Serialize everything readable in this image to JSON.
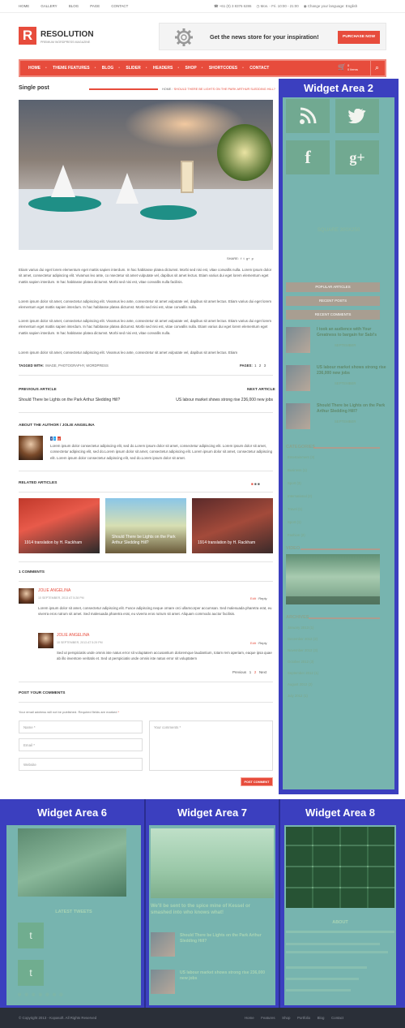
{
  "topbar": {
    "nav": [
      "HOME",
      "GALLERY",
      "BLOG",
      "PAGE",
      "CONTACT"
    ],
    "phone": "+61 (0) 3 8376 6286",
    "hours": "Mon. - Fri. 10:00 - 21:00",
    "language_label": "Change your language:",
    "language": "English"
  },
  "header": {
    "logo_letter": "R",
    "logo_title": "RESOLUTION",
    "logo_sub": "PREMIUM WORDPRESS MAGAZINE",
    "banner_text": "Get the news store for your inspiration!",
    "banner_button": "PURCHASE NOW"
  },
  "mainnav": {
    "items": [
      "HOME",
      "THEME FEATURES",
      "BLOG",
      "SLIDER",
      "HEADERS",
      "SHOP",
      "SHORTCODES",
      "CONTACT"
    ],
    "cart_count": "0",
    "cart_label": "0 items"
  },
  "page": {
    "title": "Single post",
    "breadcrumb_home": "HOME",
    "breadcrumb_current": "SHOULD THERE BE LIGHTS ON THE PARK ARTHUR SLEDDING HILL?"
  },
  "article": {
    "share_label": "SHARE:",
    "paragraphs": [
      "Etiam varius dui eget lorem elementum eget mattis sapien interdum. In hac habitasse platea dictumst. Morbi sed nisi est, vitae convallis nulla. Lorem ipsum dolor sit amet, consectetur adipiscing elit. Vivamus leo ante, co nsectetur sit amet vulputate vel, dapibus sit amet lectus. Etiam varius dui eget lorem elementum eget mattis sapien interdum. In hac habitasse platea dictumst. Morbi sed nisi est, vitae convallis nulla facilisis.",
      "Lorem ipsum dolor sit amet, consectetur adipiscing elit. Vivamus leo ante, consectetur sit amet vulputate vel, dapibus sit amet lectus. Etiam varius dui eget lorem elementum eget mattis sapien interdum. In hac habitasse platea dictumst. Morbi sed nisi est, vitae convallis nulla.",
      "Lorem ipsum dolor sit amet, consectetur adipiscing elit. Vivamus leo ante, consectetur sit amet vulputate vel, dapibus sit amet lectus. Etiam varius dui eget lorem elementum eget mattis sapien interdum. In hac habitasse platea dictumst. Morbi sed nisi est, vitae convallis nulla. Etiam varius dui eget lorem elementum eget mattis sapien interdum. In hac habitasse platea dictumst. Morbi sed nisi est, vitae convallis nulla.",
      "Lorem ipsum dolor sit amet, consectetur adipiscing elit. Vivamus leo ante, consectetur sit amet vulputate vel, dapibus sit amet lectus. Etiam"
    ],
    "tagged_label": "TAGGED WITH:",
    "tags": "IMAGE, PHOTOGRAPHY, WORDPRESS",
    "pages_label": "PAGES:",
    "pages": [
      "1",
      "2",
      "3"
    ],
    "prev_label": "PREVIOUS ARTICLE",
    "prev_title": "Should There be Lights on the Park Arthur Sledding Hill?",
    "next_label": "NEXT ARTICLE",
    "next_title": "US labour market shows strong rise 236,000 new jobs",
    "author_heading": "ABOUT THE AUTHOR / JOLIE ANGELINA",
    "author_bio": "Lorem ipsum dolor consectetur adipiscing elit, sed do.Lorem ipsum dolor sit amet, consectetur adipiscing elit. Lorem ipsum dolor sit amet, consectetur adipiscing elit, sed do.Lorem ipsum dolor sit amet, consectetur adipiscing elit. Lorem ipsum dolor sit amet, consectetur adipiscing elit. Lorem ipsum dolor consectetur adipiscing elit, sed do.Lorem ipsum dolor sit amet."
  },
  "related": {
    "heading": "RELATED ARTICLES",
    "items": [
      "1914 translation by H. Rackham",
      "Should There be Lights on the Park Arthur Sledding Hill?",
      "1914 translation by H. Rackham"
    ]
  },
  "comments": {
    "heading": "1 COMMENTS",
    "list": [
      {
        "author": "JOLIE ANGELINA",
        "date": "10 SEPTEMBER, 2013 AT 5:28 PM",
        "edit": "Edit",
        "reply": "Reply",
        "text": "Lorem ipsum dolor sit amet, consectetur adipiscing elit. Fusce adipiscing neque ornare orci ullamcorper accumsan. Sed malesuada pharetra erat, eu viverra eros rutrum sit amet. Sed malesuada pharetra erat, eu viverra eros rutrum sit amet. Aliquam commodo auctor facilisis."
      },
      {
        "author": "JOLIE ANGELINA",
        "date": "10 SEPTEMBER, 2013 AT 5:29 PM",
        "edit": "Edit",
        "reply": "Reply",
        "text": "Sed ut perspiciatis unde omnis iste natus error sit voluptatem accusantium doloremque laudantium, totam rem aperiam, eaque ipsa quae ab illo inventore veritatis et. Sed ut perspiciatis unde omnis iste natus error sit voluptatem"
      }
    ],
    "pager_prev": "Previous",
    "pager_pages": [
      "1",
      "2"
    ],
    "pager_next": "Next"
  },
  "form": {
    "heading": "POST YOUR COMMENTS",
    "note": "Your email address will not be published. Required fields are marked",
    "required_mark": "*",
    "name_placeholder": "Name *",
    "email_placeholder": "Email *",
    "website_placeholder": "Website",
    "comment_placeholder": "Your comments *",
    "submit": "POST COMMENT"
  },
  "sidebar": {
    "label": "Widget Area 2",
    "ad_text": "SQUARE 300X250",
    "tabs": [
      "POPULAR ARTICLES",
      "RECENT POSTS",
      "RECENT COMMENTS"
    ],
    "posts": [
      {
        "title": "I took an audience with Your Greatness to bargain for Sabi's",
        "meta": "SEPTEMBER"
      },
      {
        "title": "US labour market shows strong rise 236,000 new jobs",
        "meta": "SEPTEMBER"
      },
      {
        "title": "Should There be Lights on the Park Arthur Sledding Hill?",
        "meta": "SEPTEMBER"
      }
    ],
    "categories_heading": "CATEGORIES",
    "categories": [
      "Entertainment (3)",
      "Business (1)",
      "Sport (3)",
      "International (2)",
      "Travel (1)",
      "Sport (1)",
      "Fashion (2)"
    ],
    "video_heading": "VIDEO",
    "archives_heading": "ARCHIVES",
    "archives": [
      "January 2013 (1)",
      "December 2012 (2)",
      "November 2012 (3)",
      "October 2012 (3)",
      "September 2012 (1)",
      "August 2012 (2)",
      "July 2012 (1)"
    ]
  },
  "footer": {
    "area6_label": "Widget Area 6",
    "area6_heading": "LATEST TWEETS",
    "area7_label": "Widget Area 7",
    "area7_headline": "We'll be sent to the spice mine of Kessel or smashed into who knows what!",
    "area7_posts": [
      "Should There be Lights on the Park Arthur Sledding Hill?",
      "US labour market shows strong rise 236,000 new jobs"
    ],
    "area8_label": "Widget Area 8",
    "area8_heading": "ABOUT",
    "copyright": "© Copyright 2013 - Kopasoft. All Rights Reserved",
    "links": [
      "Home",
      "Features",
      "Shop",
      "Portfolio",
      "Blog",
      "Contact"
    ]
  },
  "colors": {
    "accent": "#e74c3c",
    "widget_border": "#3b3fbf",
    "widget_fill": "#8cdcaa"
  }
}
